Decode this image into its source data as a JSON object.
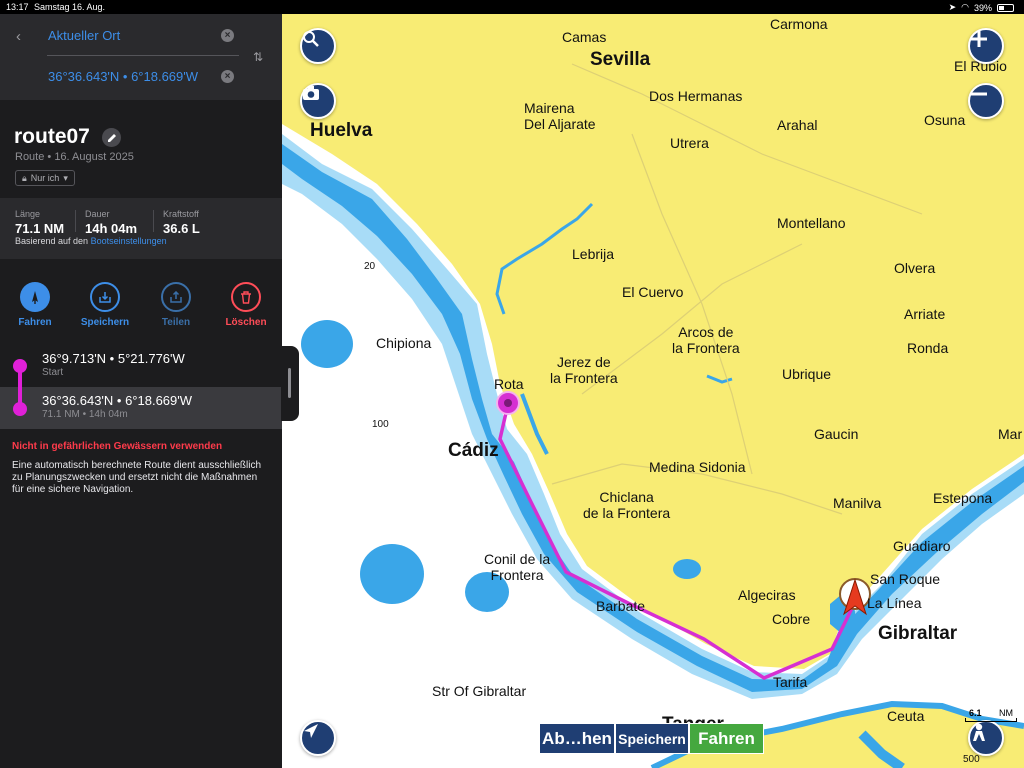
{
  "status_bar": {
    "time": "13:17",
    "date": "Samstag 16. Aug.",
    "battery": "39%"
  },
  "route_search": {
    "from_value": "Aktueller Ort",
    "to_value": "36°36.643'N • 6°18.669'W"
  },
  "route": {
    "name": "route07",
    "subtitle": "Route • 16. August 2025",
    "visibility": "Nur ich"
  },
  "stats": {
    "length_label": "Länge",
    "length_value": "71.1 NM",
    "duration_label": "Dauer",
    "duration_value": "14h 04m",
    "fuel_label": "Kraftstoff",
    "fuel_value": "36.6 L",
    "basis_text": "Basierend auf den ",
    "basis_link": "Bootseinstellungen"
  },
  "actions": [
    {
      "label": "Fahren",
      "icon": "navigate-icon",
      "color": "#3d8ee8"
    },
    {
      "label": "Speichern",
      "icon": "save-icon",
      "color": "#3d8ee8"
    },
    {
      "label": "Teilen",
      "icon": "share-icon",
      "color": "#3a6fa8"
    },
    {
      "label": "Löschen",
      "icon": "trash-icon",
      "color": "#ff4d58"
    }
  ],
  "waypoints": [
    {
      "coords": "36°9.713'N • 5°21.776'W",
      "sub": "Start"
    },
    {
      "coords": "36°36.643'N • 6°18.669'W",
      "sub": "71.1 NM • 14h 04m"
    }
  ],
  "warning": {
    "title": "Nicht in gefährlichen Gewässern verwenden",
    "text": "Eine automatisch berechnete Route dient ausschließlich zu Planungszwecken und ersetzt nicht die Maßnahmen für eine sichere Navigation."
  },
  "map": {
    "colors": {
      "land": "#f8ec74",
      "shallow": "#3aa6e8",
      "route": "#d62fd2",
      "button": "#1f3e73",
      "go": "#45a83f"
    },
    "places": [
      {
        "name": "Carmona",
        "size": "normal"
      },
      {
        "name": "Camas",
        "size": "normal"
      },
      {
        "name": "Sevilla",
        "size": "big"
      },
      {
        "name": "El Rubio",
        "size": "normal"
      },
      {
        "name": "Mairena\nDel Aljarate",
        "size": "normal"
      },
      {
        "name": "Dos Hermanas",
        "size": "normal"
      },
      {
        "name": "Huelva",
        "size": "big"
      },
      {
        "name": "Arahal",
        "size": "normal"
      },
      {
        "name": "Osuna",
        "size": "normal"
      },
      {
        "name": "Utrera",
        "size": "normal"
      },
      {
        "name": "Montellano",
        "size": "normal"
      },
      {
        "name": "Lebrija",
        "size": "normal"
      },
      {
        "name": "Olvera",
        "size": "normal"
      },
      {
        "name": "El Cuervo",
        "size": "normal"
      },
      {
        "name": "Arriate",
        "size": "normal"
      },
      {
        "name": "Chipiona",
        "size": "normal"
      },
      {
        "name": "Arcos de\nla Frontera",
        "size": "normal"
      },
      {
        "name": "Ronda",
        "size": "normal"
      },
      {
        "name": "Jerez de\nla Frontera",
        "size": "normal"
      },
      {
        "name": "Ubrique",
        "size": "normal"
      },
      {
        "name": "Rota",
        "size": "normal"
      },
      {
        "name": "Gaucin",
        "size": "normal"
      },
      {
        "name": "Mar",
        "size": "normal"
      },
      {
        "name": "Cádiz",
        "size": "big"
      },
      {
        "name": "Medina Sidonia",
        "size": "normal"
      },
      {
        "name": "Estepona",
        "size": "normal"
      },
      {
        "name": "Chiclana\nde la Frontera",
        "size": "normal"
      },
      {
        "name": "Manilva",
        "size": "normal"
      },
      {
        "name": "Guadiaro",
        "size": "normal"
      },
      {
        "name": "Conil de la\nFrontera",
        "size": "normal"
      },
      {
        "name": "San Roque",
        "size": "normal"
      },
      {
        "name": "La Línea",
        "size": "normal"
      },
      {
        "name": "Algeciras",
        "size": "normal"
      },
      {
        "name": "Barbate",
        "size": "normal"
      },
      {
        "name": "Gibraltar",
        "size": "big"
      },
      {
        "name": "Cobre",
        "size": "normal"
      },
      {
        "name": "Tarifa",
        "size": "normal"
      },
      {
        "name": "Str Of Gibraltar",
        "size": "normal"
      },
      {
        "name": "Tanger",
        "size": "big"
      },
      {
        "name": "Ceuta",
        "size": "normal"
      },
      {
        "name": "20",
        "size": "depth"
      },
      {
        "name": "100",
        "size": "depth"
      },
      {
        "name": "500",
        "size": "depth"
      }
    ],
    "scale_value": "6.1",
    "scale_unit": "NM",
    "bottom_buttons": [
      "Ab…hen",
      "Speichern",
      "Fahren"
    ]
  }
}
